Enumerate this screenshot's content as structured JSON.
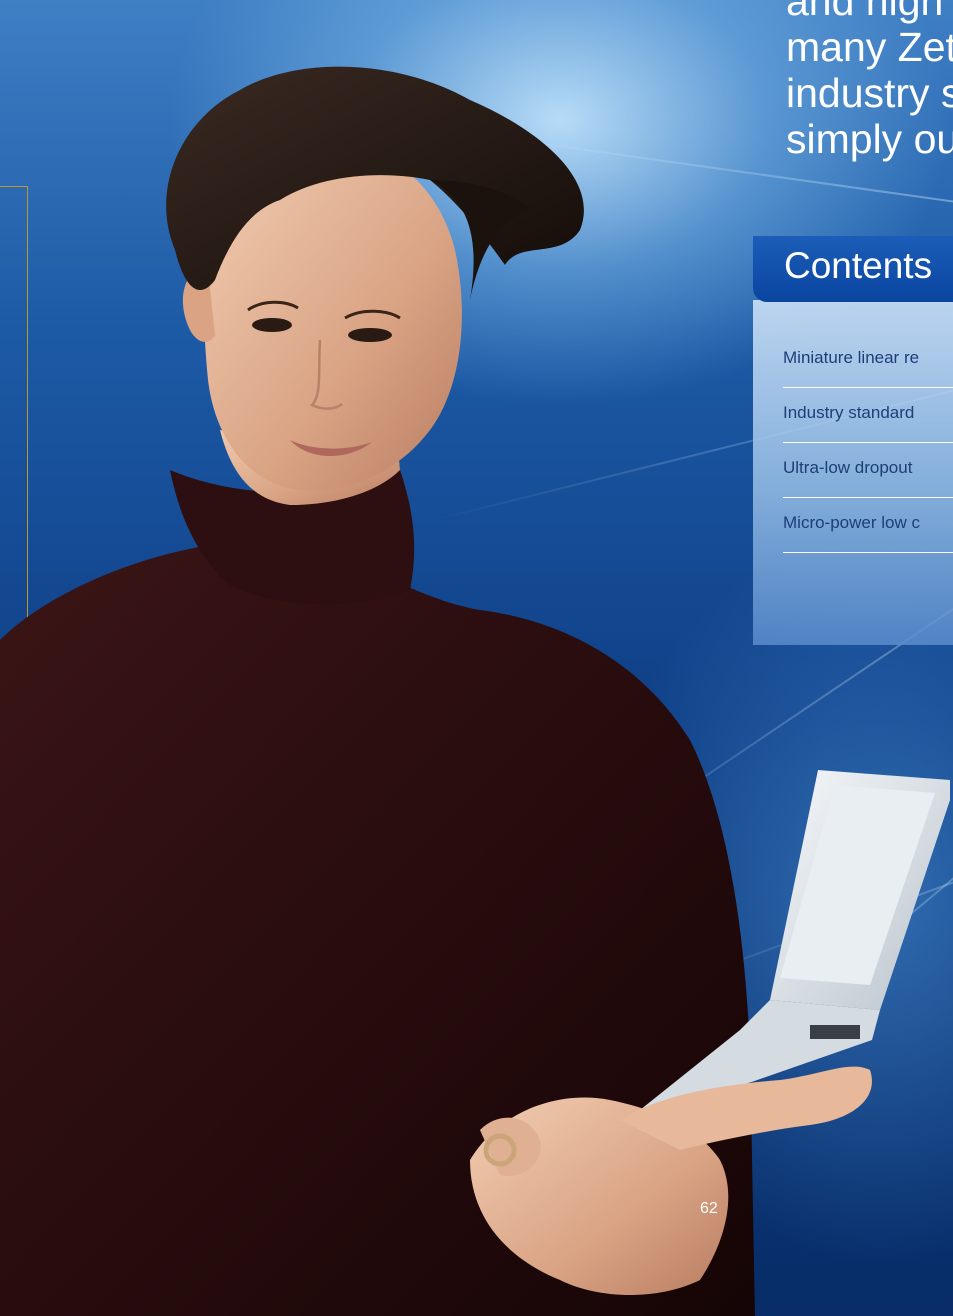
{
  "intro": {
    "lines": [
      "and high cu",
      "many Zetex",
      "industry sta",
      "simply outp"
    ]
  },
  "contents": {
    "title": "Contents",
    "items": [
      {
        "label": "Miniature linear re"
      },
      {
        "label": "Industry standard"
      },
      {
        "label": "Ultra-low dropout"
      },
      {
        "label": "Micro-power low c"
      }
    ]
  },
  "page_number": "62",
  "colors": {
    "background_blue": "#0e3f86",
    "tab_blue": "#0a45a0",
    "frame_rule": "#b79a2a",
    "list_text": "#1d3f78"
  }
}
